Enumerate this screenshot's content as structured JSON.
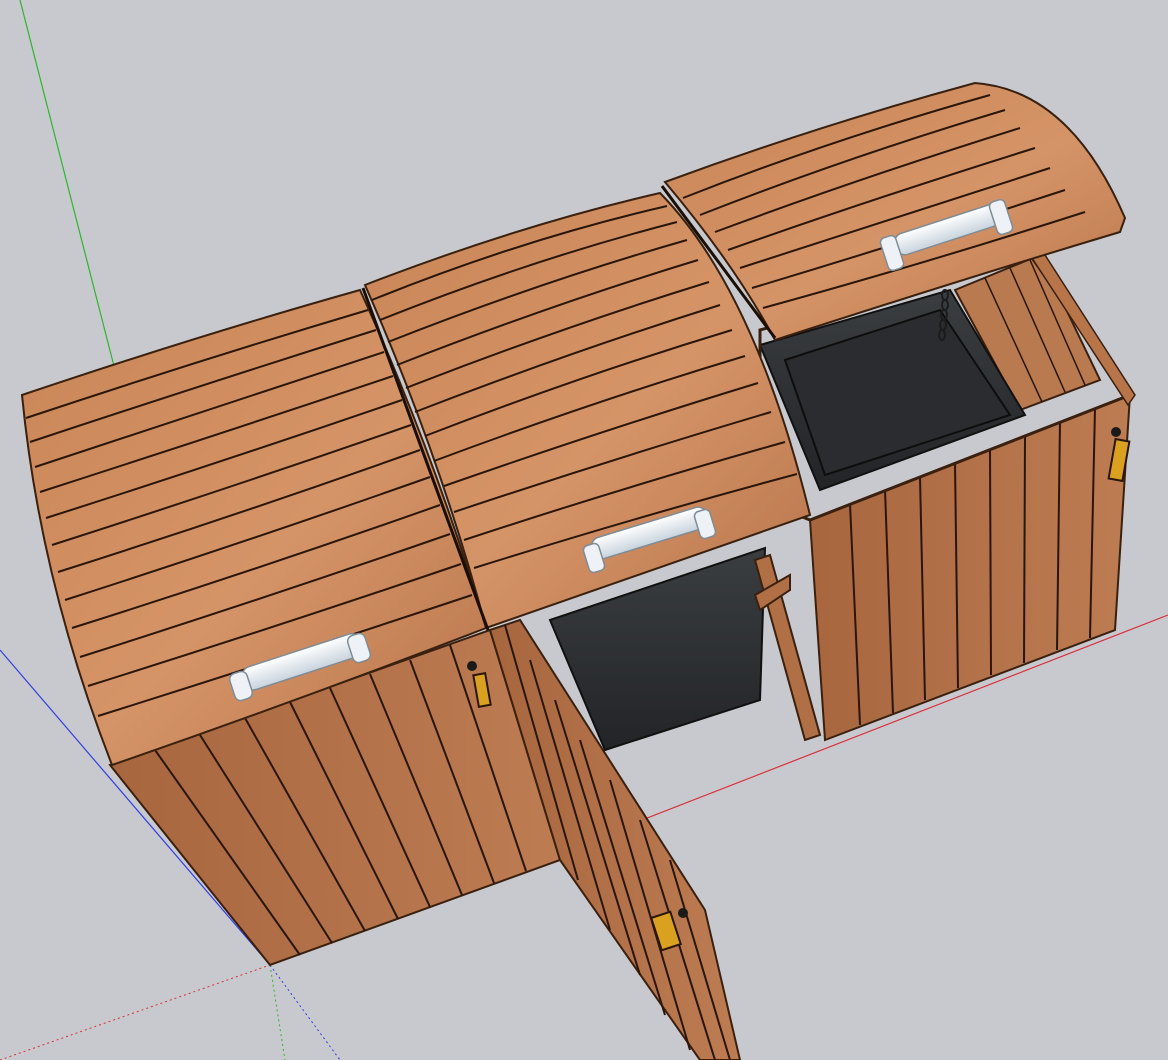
{
  "viewport": {
    "background_color": "#c8c9ce"
  },
  "axes": {
    "green_axis_color": "#2db52d",
    "blue_axis_color": "#2f3ee6",
    "red_axis_color": "#d9303a"
  },
  "model": {
    "wood_color": "#b9764c",
    "wood_dark": "#8f5532",
    "bin_color": "#2d2f31",
    "handle_color": "#e6ecf2",
    "latch_color": "#d9a11f",
    "parts": [
      "lid-left",
      "lid-middle",
      "lid-right-open",
      "front-door-left",
      "front-door-middle-open",
      "side-panel-right",
      "bin-middle",
      "bin-right",
      "handle-left",
      "handle-middle",
      "handle-right",
      "chain",
      "latch-left",
      "latch-door",
      "latch-right"
    ]
  }
}
